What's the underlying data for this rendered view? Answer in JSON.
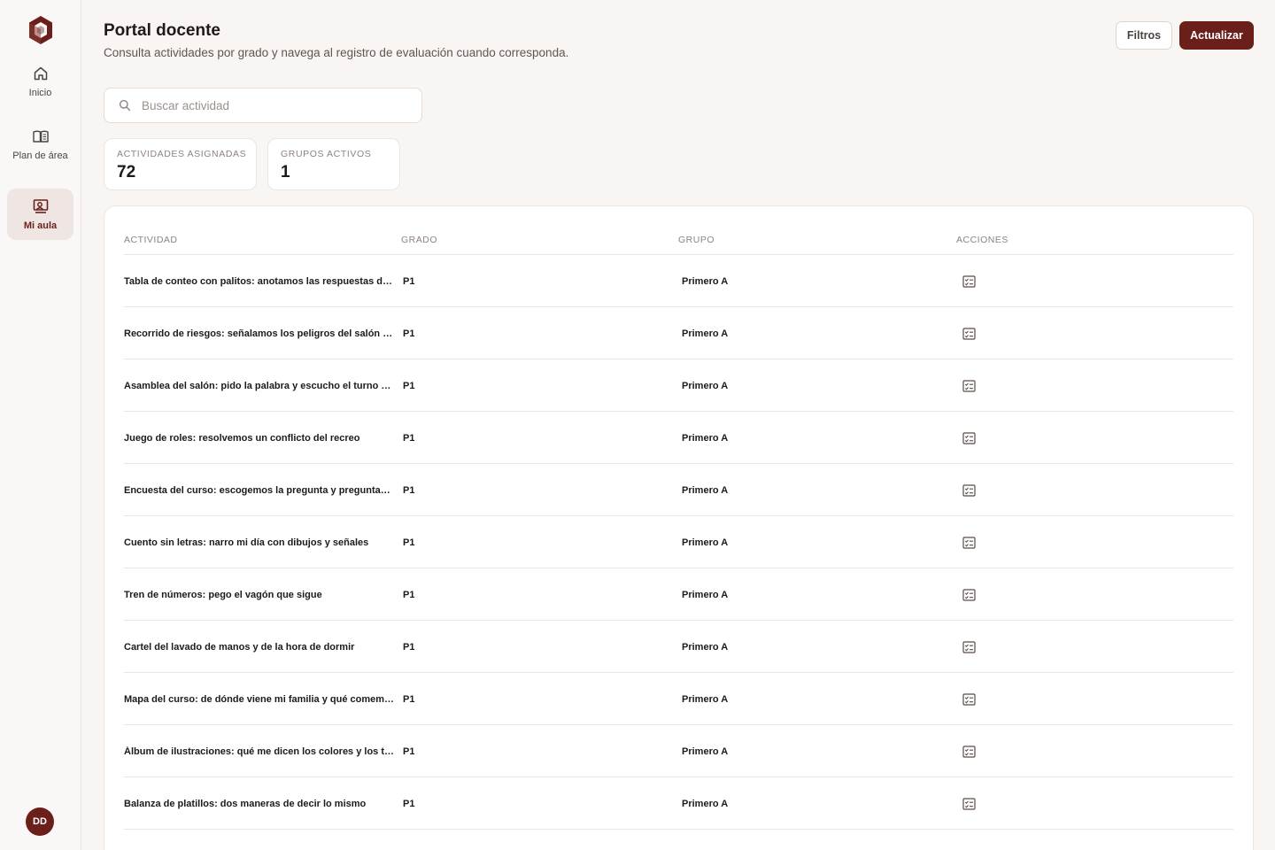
{
  "sidebar": {
    "items": [
      {
        "label": "Inicio",
        "icon": "home-icon"
      },
      {
        "label": "Plan de área",
        "icon": "book-icon"
      },
      {
        "label": "Mi aula",
        "icon": "classroom-icon",
        "active": true
      }
    ],
    "avatar": "DD"
  },
  "header": {
    "title": "Portal docente",
    "subtitle": "Consulta actividades por grado y navega al registro de evaluación cuando corresponda.",
    "filter_label": "Filtros",
    "update_label": "Actualizar"
  },
  "search": {
    "placeholder": "Buscar actividad",
    "value": ""
  },
  "stats": [
    {
      "label": "Actividades asignadas",
      "value": "72"
    },
    {
      "label": "Grupos activos",
      "value": "1"
    }
  ],
  "table": {
    "columns": [
      "Actividad",
      "Grado",
      "Grupo",
      "Acciones"
    ],
    "rows": [
      {
        "actividad": "Tabla de conteo con palitos: anotamos las respuestas del curso",
        "grado": "P1",
        "grupo": "Primero A"
      },
      {
        "actividad": "Recorrido de riesgos: señalamos los peligros del salón y del patio",
        "grado": "P1",
        "grupo": "Primero A"
      },
      {
        "actividad": "Asamblea del salón: pido la palabra y escucho el turno del otro",
        "grado": "P1",
        "grupo": "Primero A"
      },
      {
        "actividad": "Juego de roles: resolvemos un conflicto del recreo",
        "grado": "P1",
        "grupo": "Primero A"
      },
      {
        "actividad": "Encuesta del curso: escogemos la pregunta y preguntamos a todos",
        "grado": "P1",
        "grupo": "Primero A"
      },
      {
        "actividad": "Cuento sin letras: narro mi día con dibujos y señales",
        "grado": "P1",
        "grupo": "Primero A"
      },
      {
        "actividad": "Tren de números: pego el vagón que sigue",
        "grado": "P1",
        "grupo": "Primero A"
      },
      {
        "actividad": "Cartel del lavado de manos y de la hora de dormir",
        "grado": "P1",
        "grupo": "Primero A"
      },
      {
        "actividad": "Mapa del curso: de dónde viene mi familia y qué comemos en casa",
        "grado": "P1",
        "grupo": "Primero A"
      },
      {
        "actividad": "Álbum de ilustraciones: qué me dicen los colores y los tamaños",
        "grado": "P1",
        "grupo": "Primero A"
      },
      {
        "actividad": "Balanza de platillos: dos maneras de decir lo mismo",
        "grado": "P1",
        "grupo": "Primero A"
      },
      {
        "actividad": "",
        "grado": "",
        "grupo": ""
      }
    ]
  },
  "colors": {
    "accent": "#6b1f1b",
    "background": "#f8f5f3",
    "border": "#ece5e1"
  }
}
